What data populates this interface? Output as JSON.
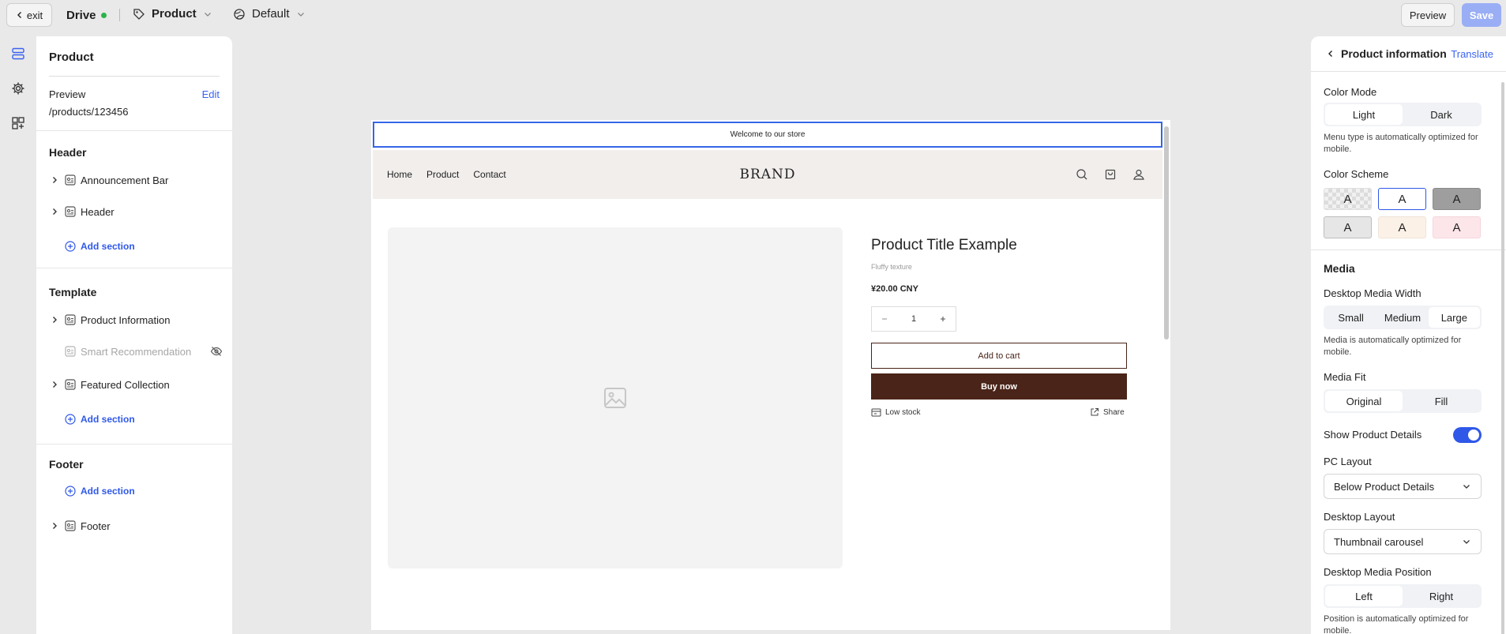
{
  "topbar": {
    "exit_label": "exit",
    "store_name": "Drive",
    "status_color": "#2bb34b",
    "page_type": "Product",
    "theme": "Default",
    "preview_label": "Preview",
    "save_label": "Save"
  },
  "left_panel": {
    "title": "Product",
    "preview_label": "Preview",
    "preview_path": "/products/123456",
    "edit_label": "Edit",
    "header_group": "Header",
    "header_items": [
      "Announcement Bar",
      "Header"
    ],
    "template_group": "Template",
    "template_items": [
      "Product Information",
      "Smart Recommendation",
      "Featured Collection"
    ],
    "footer_group": "Footer",
    "footer_items": [
      "Footer"
    ],
    "add_section_label": "Add section"
  },
  "preview": {
    "announcement": "Welcome to our store",
    "nav_links": [
      "Home",
      "Product",
      "Contact"
    ],
    "brand": "BRAND",
    "product_title": "Product Title Example",
    "subtitle": "Fluffy texture",
    "price": "¥20.00 CNY",
    "quantity": "1",
    "add_to_cart": "Add to cart",
    "buy_now": "Buy now",
    "stock": "Low stock",
    "share": "Share",
    "accent_color": "#4a2418"
  },
  "right_panel": {
    "title": "Product information",
    "translate_label": "Translate",
    "color_mode_label": "Color Mode",
    "color_mode_options": [
      "Light",
      "Dark"
    ],
    "color_mode_note": "Menu type is automatically optimized for mobile.",
    "color_scheme_label": "Color Scheme",
    "swatch_letter": "A",
    "media_section": "Media",
    "media_width_label": "Desktop Media Width",
    "media_width_options": [
      "Small",
      "Medium",
      "Large"
    ],
    "media_width_note": "Media is automatically optimized for mobile.",
    "media_fit_label": "Media Fit",
    "media_fit_options": [
      "Original",
      "Fill"
    ],
    "show_details_label": "Show Product Details",
    "show_details_on": true,
    "pc_layout_label": "PC Layout",
    "pc_layout_value": "Below Product Details",
    "desktop_layout_label": "Desktop Layout",
    "desktop_layout_value": "Thumbnail carousel",
    "media_position_label": "Desktop Media Position",
    "media_position_options": [
      "Left",
      "Right"
    ],
    "media_position_note": "Position is automatically optimized for mobile.",
    "toggle_color": "#2f58e8"
  }
}
